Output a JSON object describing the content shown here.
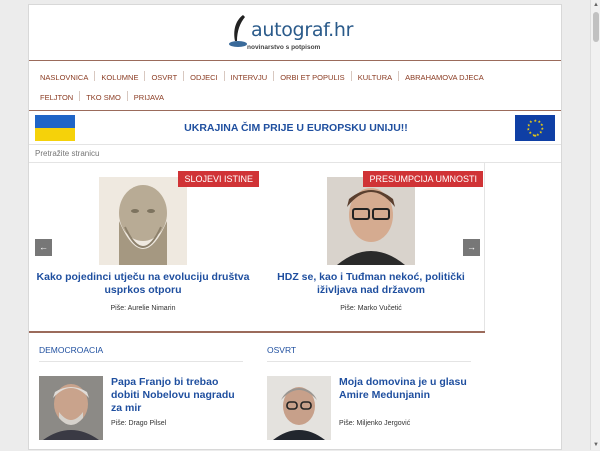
{
  "header": {
    "logo_text": "autograf.hr",
    "logo_tagline": "novinarstvo s potpisom"
  },
  "nav": {
    "items": [
      "Naslovnica",
      "Kolumne",
      "Osvrt",
      "Odjeci",
      "Intervju",
      "Orbi et populis",
      "Kultura",
      "Abrahamova djeca",
      "Feljton",
      "Tko smo",
      "Prijava"
    ]
  },
  "banner": {
    "text": "UKRAJINA ČIM PRIJE U EUROPSKU UNIJU!!",
    "flag_left": "ukraine-flag",
    "flag_right": "eu-flag"
  },
  "search": {
    "placeholder": "Pretražite stranicu"
  },
  "slider": {
    "prev_label": "←",
    "next_label": "→",
    "slides": [
      {
        "badge": "SLOJEVI ISTINE",
        "title": "Kako pojedinci utječu na evoluciju društva usprkos otporu",
        "author": "Piše: Aurelie Nimarin"
      },
      {
        "badge": "PRESUMPCIJA UMNOSTI",
        "title": "HDZ se, kao i Tuđman nekoć, politički iživljava nad državom",
        "author": "Piše: Marko Vučetić"
      }
    ]
  },
  "sections": [
    {
      "heading": "DEMOCROACIA",
      "title": "Papa Franjo bi trebao dobiti Nobelovu nagradu za mir",
      "author": "Piše: Drago Pilsel"
    },
    {
      "heading": "OSVRT",
      "title": "Moja domovina je u glasu Amire Medunjanin",
      "author": "Piše: Miljenko Jergović"
    }
  ],
  "colors": {
    "accent_blue": "#1f4f9f",
    "nav_brown": "#8a3b22",
    "badge_red": "#d03336"
  }
}
